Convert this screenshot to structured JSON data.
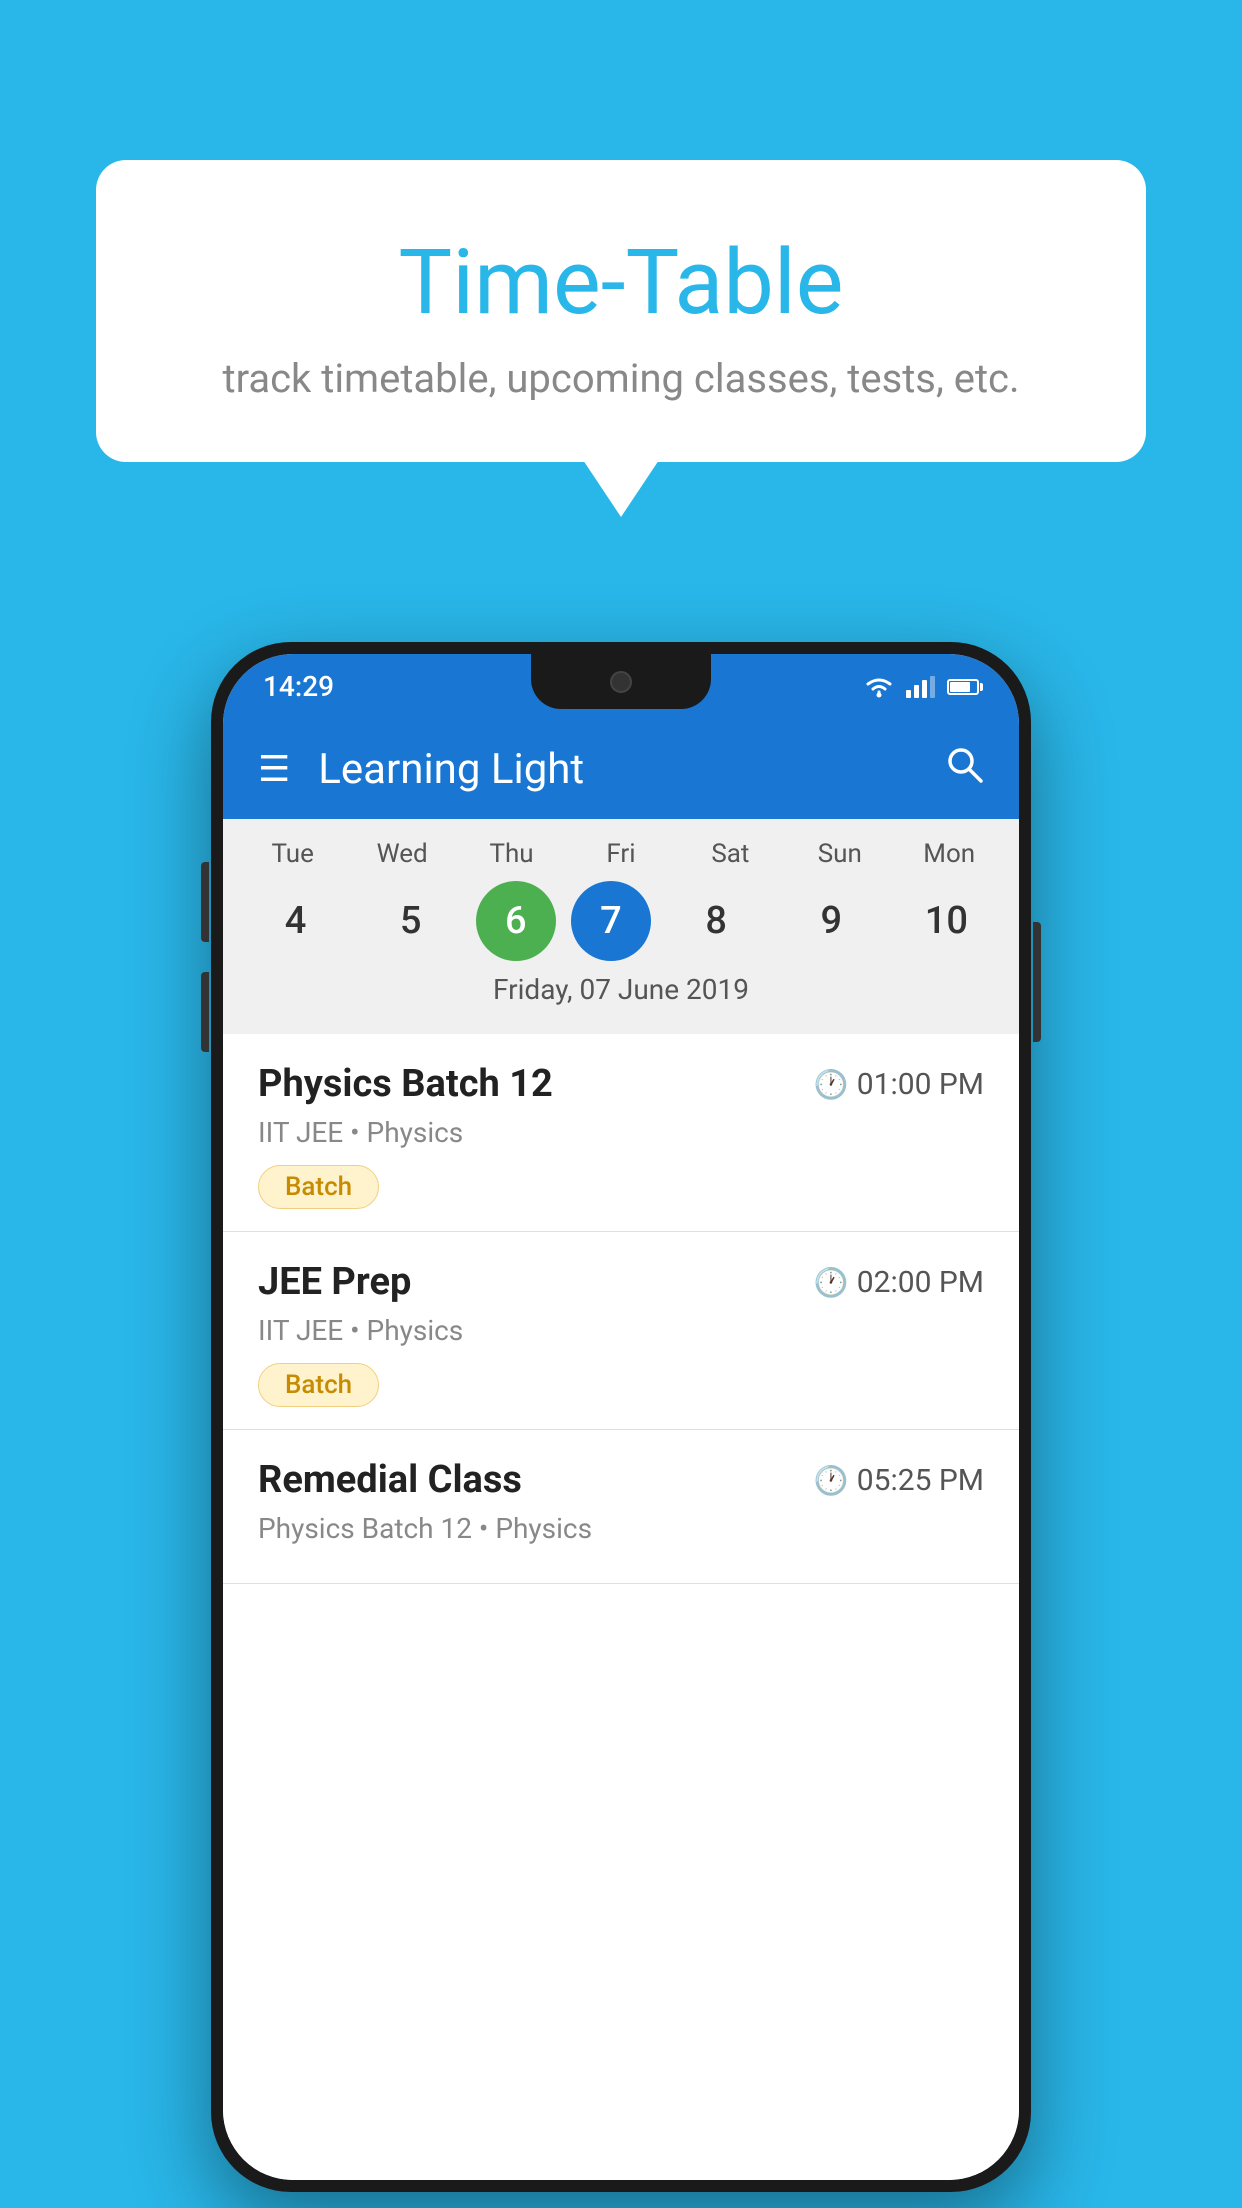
{
  "background_color": "#29B6E8",
  "hero": {
    "bubble_title": "Time-Table",
    "bubble_subtitle": "track timetable, upcoming classes, tests, etc."
  },
  "phone": {
    "status_bar": {
      "time": "14:29"
    },
    "app_bar": {
      "title": "Learning Light"
    },
    "calendar": {
      "days": [
        {
          "label": "Tue",
          "number": "4"
        },
        {
          "label": "Wed",
          "number": "5"
        },
        {
          "label": "Thu",
          "number": "6",
          "state": "today"
        },
        {
          "label": "Fri",
          "number": "7",
          "state": "selected"
        },
        {
          "label": "Sat",
          "number": "8"
        },
        {
          "label": "Sun",
          "number": "9"
        },
        {
          "label": "Mon",
          "number": "10"
        }
      ],
      "selected_date_label": "Friday, 07 June 2019"
    },
    "schedule": [
      {
        "title": "Physics Batch 12",
        "time": "01:00 PM",
        "sub": "IIT JEE • Physics",
        "tag": "Batch"
      },
      {
        "title": "JEE Prep",
        "time": "02:00 PM",
        "sub": "IIT JEE • Physics",
        "tag": "Batch"
      },
      {
        "title": "Remedial Class",
        "time": "05:25 PM",
        "sub": "Physics Batch 12 • Physics",
        "tag": ""
      }
    ]
  }
}
